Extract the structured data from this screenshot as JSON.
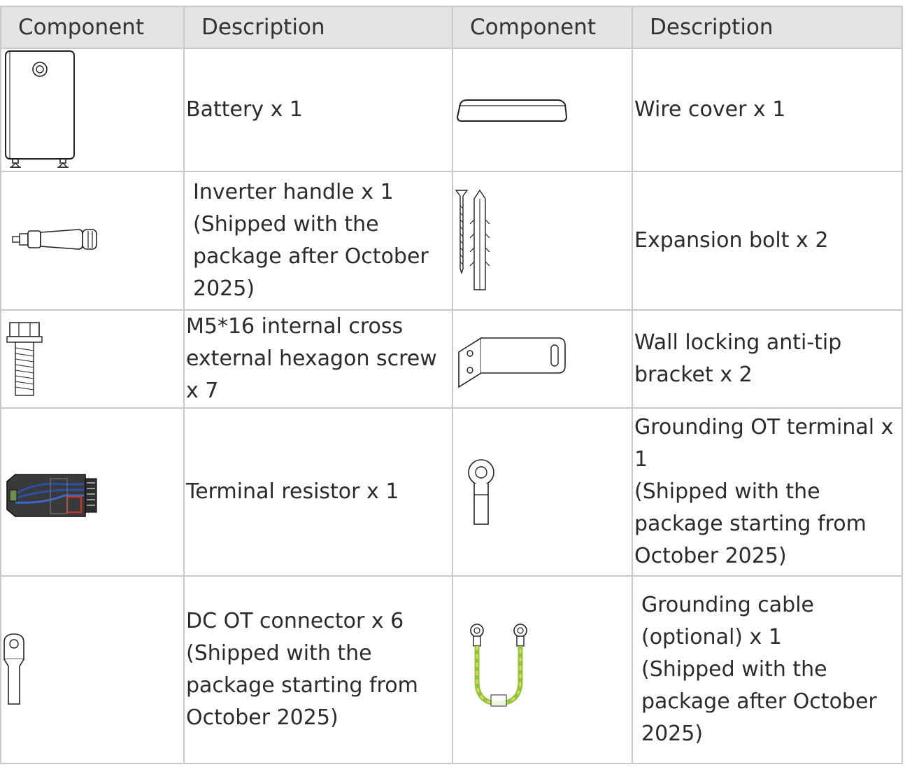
{
  "header": [
    "Component",
    "Description",
    "Component",
    "Description"
  ],
  "rows": [
    {
      "left": {
        "icon": "battery-icon",
        "lines": [
          "Battery x 1"
        ]
      },
      "right": {
        "icon": "wire-cover-icon",
        "lines": [
          "Wire cover x 1"
        ]
      }
    },
    {
      "left": {
        "icon": "inverter-handle-icon",
        "lines": [
          "Inverter handle x 1",
          "(Shipped with the",
          "package after October",
          "2025)"
        ]
      },
      "right": {
        "icon": "expansion-bolt-icon",
        "lines": [
          "Expansion bolt x 2"
        ]
      }
    },
    {
      "left": {
        "icon": "hex-screw-icon",
        "lines": [
          "M5*16 internal cross",
          "external hexagon screw",
          "x 7"
        ]
      },
      "right": {
        "icon": "anti-tip-bracket-icon",
        "lines": [
          "Wall locking anti-tip",
          "bracket x 2"
        ]
      }
    },
    {
      "left": {
        "icon": "terminal-resistor-icon",
        "lines": [
          "Terminal resistor x 1"
        ]
      },
      "right": {
        "icon": "ot-terminal-icon",
        "lines": [
          "Grounding OT terminal x",
          "1",
          "(Shipped with the",
          "package starting from",
          "October 2025)"
        ]
      }
    },
    {
      "left": {
        "icon": "dc-ot-connector-icon",
        "lines": [
          "DC OT connector x 6",
          "(Shipped with the",
          "package starting from",
          "October 2025)"
        ]
      },
      "right": {
        "icon": "grounding-cable-icon",
        "lines": [
          "Grounding cable",
          "(optional) x 1",
          "(Shipped with the",
          "package after October",
          "2025)"
        ]
      }
    }
  ],
  "colors": {
    "header_bg": "#e4e4e4",
    "grid": "#c9c9c9",
    "text": "#2b2b2b",
    "cable_green": "#8cc63f",
    "cable_yellow": "#e8d84a",
    "resistor_blue": "#2a4fa8",
    "resistor_red": "#c0392b"
  }
}
